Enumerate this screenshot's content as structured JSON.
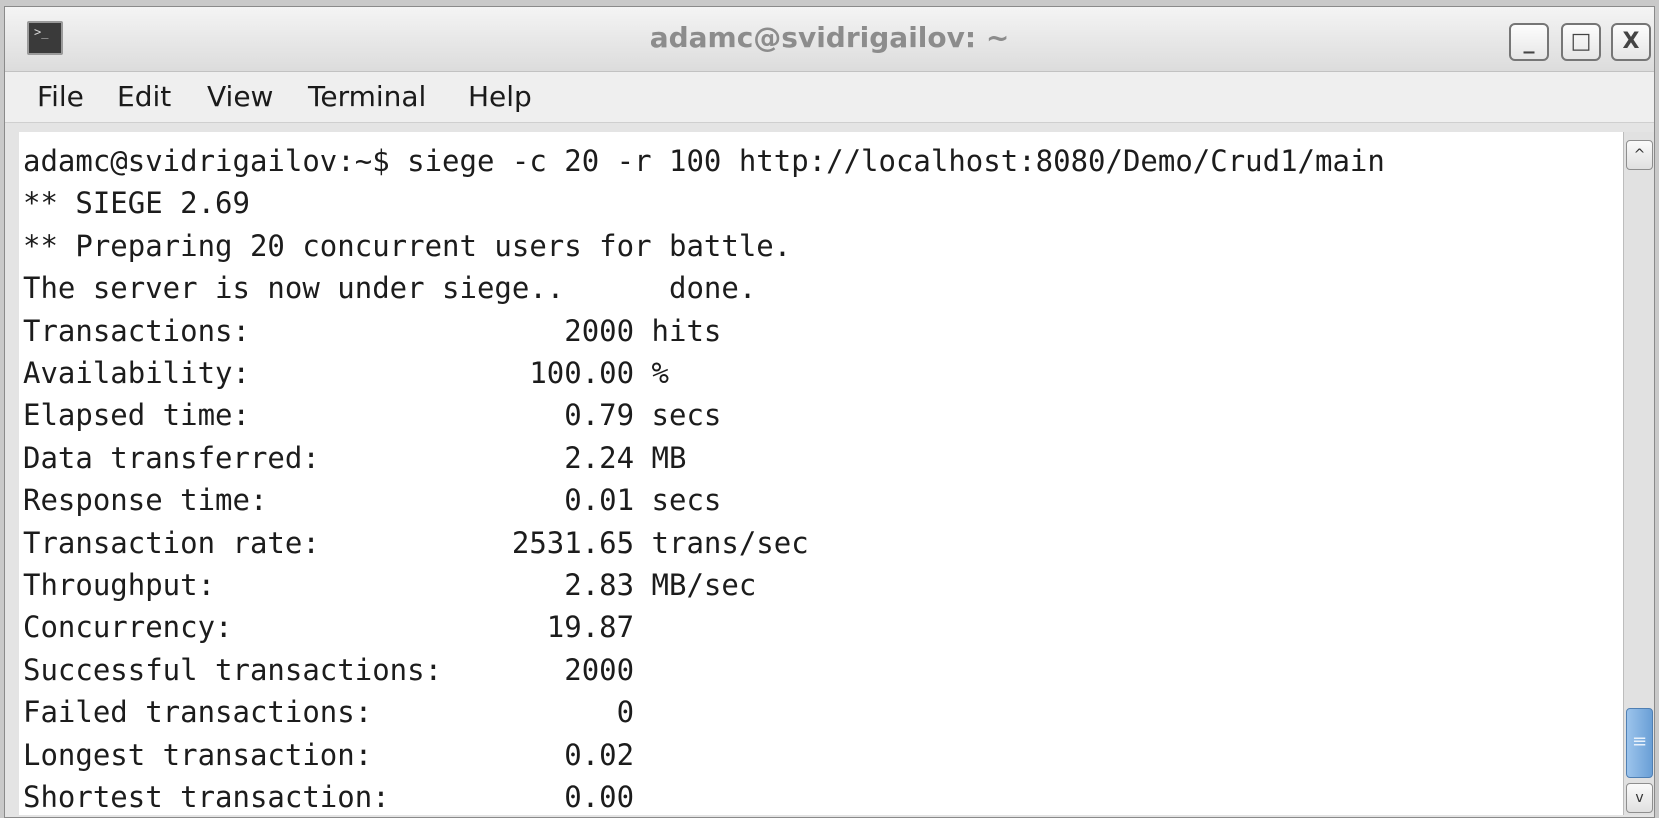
{
  "window": {
    "title": "adamc@svidrigailov: ~",
    "app_icon": "terminal-icon",
    "buttons": {
      "minimize": "_",
      "maximize": "□",
      "close": "X"
    }
  },
  "menubar": {
    "items": [
      "File",
      "Edit",
      "View",
      "Terminal",
      "Help"
    ]
  },
  "terminal": {
    "prompt_glyph": ">_",
    "lines": [
      "adamc@svidrigailov:~$ siege -c 20 -r 100 http://localhost:8080/Demo/Crud1/main",
      "** SIEGE 2.69",
      "** Preparing 20 concurrent users for battle.",
      "The server is now under siege..      done.",
      "Transactions:                  2000 hits",
      "Availability:                100.00 %",
      "Elapsed time:                  0.79 secs",
      "Data transferred:              2.24 MB",
      "Response time:                 0.01 secs",
      "Transaction rate:           2531.65 trans/sec",
      "Throughput:                    2.83 MB/sec",
      "Concurrency:                  19.87",
      "Successful transactions:       2000",
      "Failed transactions:              0",
      "Longest transaction:           0.02",
      "Shortest transaction:          0.00"
    ]
  },
  "scrollbar": {
    "up_arrow": "^",
    "down_arrow": "v",
    "thumb_grip": "≡",
    "position": 0.92
  }
}
